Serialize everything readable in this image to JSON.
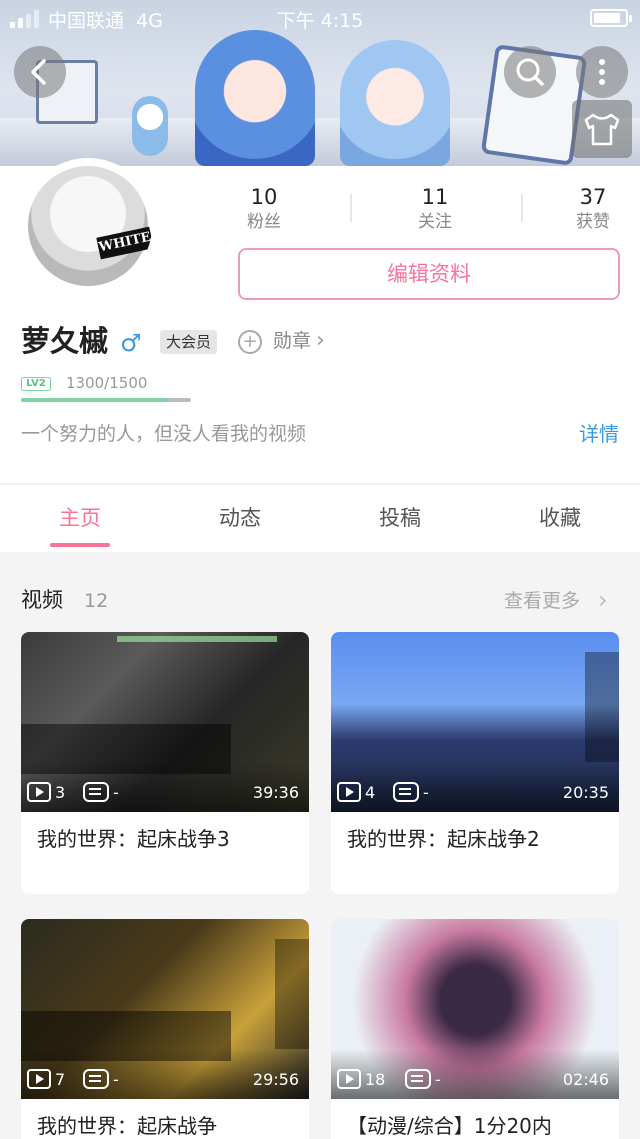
{
  "status_bar": {
    "carrier": "中国联通",
    "network": "4G",
    "time": "下午 4:15"
  },
  "icons": {
    "back": "back-arrow-icon",
    "search": "search-icon",
    "more": "more-vertical-icon",
    "theme": "shirt-icon",
    "medal": "medal-icon",
    "play": "play-icon",
    "danmaku": "danmaku-icon"
  },
  "profile": {
    "avatar_text": "WHITE",
    "stats": [
      {
        "value": "10",
        "label": "粉丝"
      },
      {
        "value": "11",
        "label": "关注"
      },
      {
        "value": "37",
        "label": "获赞"
      }
    ],
    "edit_label": "编辑资料",
    "name": "萝夂槭",
    "gender_symbol": "♂",
    "vip_label": "大会员",
    "medal_label": "勋章",
    "level_badge": "LV2",
    "exp_text": "1300/1500",
    "exp_progress": 0.867,
    "bio": "一个努力的人，但没人看我的视频",
    "detail_label": "详情"
  },
  "tabs": [
    {
      "label": "主页",
      "active": true
    },
    {
      "label": "动态",
      "active": false
    },
    {
      "label": "投稿",
      "active": false
    },
    {
      "label": "收藏",
      "active": false
    }
  ],
  "videos": {
    "section_title": "视频",
    "count": "12",
    "more_label": "查看更多",
    "items": [
      {
        "title": "我的世界：起床战争3",
        "plays": "3",
        "danmaku": "-",
        "duration": "39:36"
      },
      {
        "title": "我的世界：起床战争2",
        "plays": "4",
        "danmaku": "-",
        "duration": "20:35"
      },
      {
        "title": "我的世界：起床战争",
        "plays": "7",
        "danmaku": "-",
        "duration": "29:56"
      },
      {
        "title": "【动漫/综合】1分20内",
        "plays": "18",
        "danmaku": "-",
        "duration": "02:46"
      }
    ]
  },
  "colors": {
    "accent": "#fb7299",
    "link": "#3b9be0",
    "level": "#7fd4a4"
  }
}
